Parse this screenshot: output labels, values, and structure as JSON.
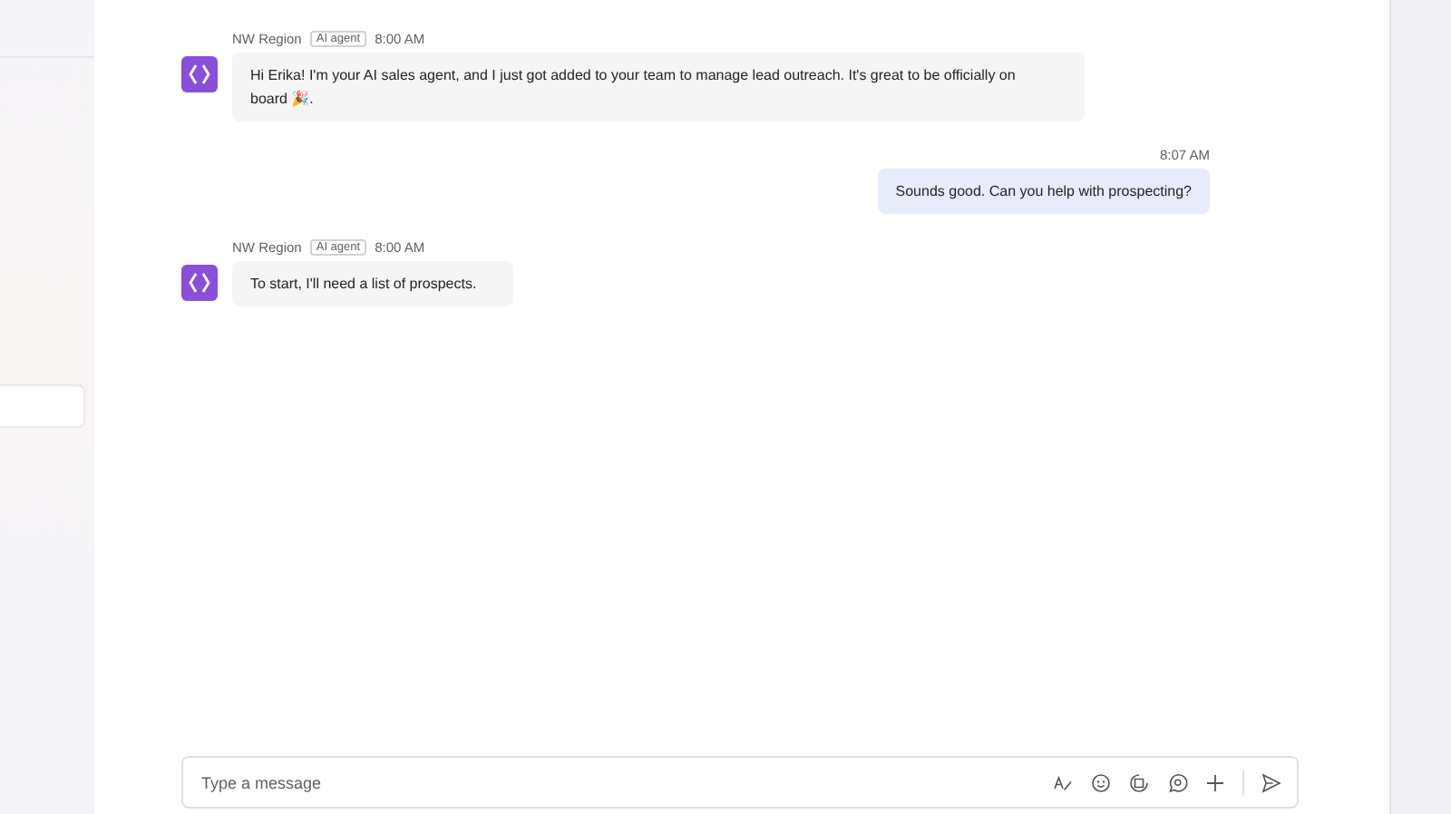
{
  "messages": [
    {
      "kind": "agent",
      "sender": "NW Region",
      "badge": "AI agent",
      "time": "8:00 AM",
      "text": "Hi Erika! I'm your AI sales agent, and I just got added to your team to manage lead outreach. It's great to be officially on board 🎉."
    },
    {
      "kind": "user",
      "time": "8:07 AM",
      "text": "Sounds good. Can you help with prospecting?"
    },
    {
      "kind": "agent",
      "sender": "NW Region",
      "badge": "AI agent",
      "time": "8:00 AM",
      "text": "To start, I'll need a list of prospects."
    }
  ],
  "composer": {
    "placeholder": "Type a message"
  }
}
